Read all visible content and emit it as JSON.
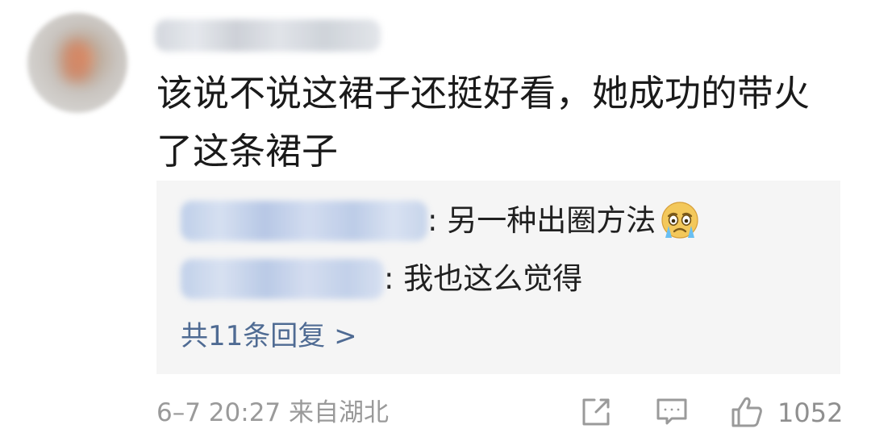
{
  "comment": {
    "text": "该说不说这裙子还挺好看，她成功的带火了这条裙子"
  },
  "replies": [
    {
      "text": ": 另一种出圈方法"
    },
    {
      "text": ": 我也这么觉得"
    }
  ],
  "more_replies_label": "共11条回复 >",
  "meta": {
    "time_location": "6–7 20:27  来自湖北"
  },
  "actions": {
    "like_count": "1052"
  },
  "icons": {
    "share": "share-icon",
    "reply": "comment-icon",
    "like": "thumbs-up-icon",
    "emoji": "crying-face-icon"
  },
  "colors": {
    "reply_bg": "#f5f5f5",
    "link": "#4f6b93",
    "meta_text": "#9a9a9a"
  }
}
